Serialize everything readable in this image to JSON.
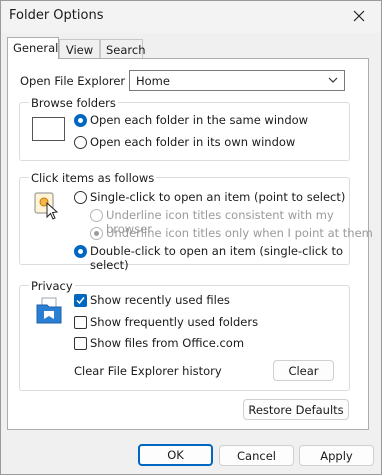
{
  "window": {
    "title": "Folder Options"
  },
  "tabs": [
    {
      "label": "General",
      "active": true
    },
    {
      "label": "View",
      "active": false
    },
    {
      "label": "Search",
      "active": false
    }
  ],
  "open_explorer": {
    "label": "Open File Explorer to:",
    "value": "Home"
  },
  "browse": {
    "title": "Browse folders",
    "options": [
      {
        "label": "Open each folder in the same window",
        "selected": true
      },
      {
        "label": "Open each folder in its own window",
        "selected": false
      }
    ]
  },
  "click_items": {
    "title": "Click items as follows",
    "single": {
      "label": "Single-click to open an item (point to select)",
      "selected": false
    },
    "sub_options": [
      {
        "label": "Underline icon titles consistent with my browser",
        "selected": false,
        "disabled": true
      },
      {
        "label": "Underline icon titles only when I point at them",
        "selected": true,
        "disabled": true
      }
    ],
    "double": {
      "label": "Double-click to open an item (single-click to select)",
      "selected": true
    }
  },
  "privacy": {
    "title": "Privacy",
    "checks": [
      {
        "label": "Show recently used files",
        "checked": true
      },
      {
        "label": "Show frequently used folders",
        "checked": false
      },
      {
        "label": "Show files from Office.com",
        "checked": false
      }
    ],
    "clear_history_label": "Clear File Explorer history",
    "clear_button": "Clear"
  },
  "restore_defaults": "Restore Defaults",
  "footer": {
    "ok": "OK",
    "cancel": "Cancel",
    "apply": "Apply"
  },
  "colors": {
    "accent": "#0067c0",
    "window_bg": "#f0f0f0",
    "panel_bg": "#ffffff"
  }
}
